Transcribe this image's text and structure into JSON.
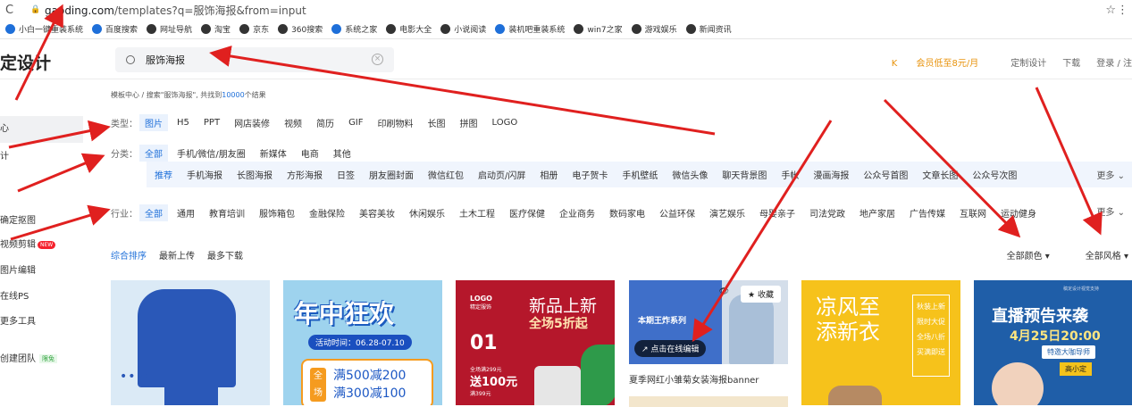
{
  "browser": {
    "url_host": "gaoding.com",
    "url_path": "/templates?q=服饰海报&from=input"
  },
  "bookmarks": [
    {
      "label": "小白一键重装系统",
      "icon": "gear-icon"
    },
    {
      "label": "百度搜索",
      "icon": "paw-icon"
    },
    {
      "label": "网址导航",
      "icon": "globe-icon"
    },
    {
      "label": "淘宝",
      "icon": "globe-icon"
    },
    {
      "label": "京东",
      "icon": "globe-icon"
    },
    {
      "label": "360搜索",
      "icon": "globe-icon"
    },
    {
      "label": "系统之家",
      "icon": "gear-icon"
    },
    {
      "label": "电影大全",
      "icon": "globe-icon"
    },
    {
      "label": "小说阅读",
      "icon": "globe-icon"
    },
    {
      "label": "装机吧重装系统",
      "icon": "computer-icon"
    },
    {
      "label": "win7之家",
      "icon": "globe-icon"
    },
    {
      "label": "游戏娱乐",
      "icon": "globe-icon"
    },
    {
      "label": "新闻资讯",
      "icon": "globe-icon"
    }
  ],
  "header": {
    "logo": "定设计",
    "search_value": "服饰海报",
    "vip": "会员低至8元/月",
    "custom_design": "定制设计",
    "download": "下载",
    "login": "登录 / 注"
  },
  "sidebar": {
    "items": [
      {
        "label": "心"
      },
      {
        "label": "计"
      },
      {
        "label": "确定抠图"
      },
      {
        "label": "视频剪辑",
        "badge": "NEW"
      },
      {
        "label": "图片编辑"
      },
      {
        "label": "在线PS"
      },
      {
        "label": "更多工具"
      },
      {
        "label": "创建团队",
        "badge": "限免"
      }
    ]
  },
  "breadcrumb": {
    "prefix": "模板中心 / 搜索\"服饰海报\", 共找到",
    "count": "10000",
    "suffix": "个结果"
  },
  "filters": {
    "type_label": "类型：",
    "types": [
      "图片",
      "H5",
      "PPT",
      "网店装修",
      "视频",
      "简历",
      "GIF",
      "印刷物料",
      "长图",
      "拼图",
      "LOGO"
    ],
    "category_label": "分类：",
    "categories": [
      "全部",
      "手机/微信/朋友圈",
      "新媒体",
      "电商",
      "其他"
    ],
    "subcategories": [
      "推荐",
      "手机海报",
      "长图海报",
      "方形海报",
      "日签",
      "朋友圈封面",
      "微信红包",
      "启动页/闪屏",
      "相册",
      "电子贺卡",
      "手机壁纸",
      "微信头像",
      "聊天背景图",
      "手帐",
      "漫画海报",
      "公众号首图",
      "文章长图",
      "公众号次图"
    ],
    "industry_label": "行业：",
    "industries": [
      "全部",
      "通用",
      "教育培训",
      "服饰箱包",
      "金融保险",
      "美容美妆",
      "休闲娱乐",
      "土木工程",
      "医疗保健",
      "企业商务",
      "数码家电",
      "公益环保",
      "演艺娱乐",
      "母婴亲子",
      "司法党政",
      "地产家居",
      "广告传媒",
      "互联网",
      "运动健身"
    ],
    "more": "更多"
  },
  "sort": {
    "options": [
      "综合排序",
      "最新上传",
      "最多下载"
    ],
    "color": "全部颜色",
    "style": "全部风格"
  },
  "cards": {
    "c2": {
      "title": "年中狂欢",
      "date": "活动时间：06.28-07.10",
      "quan": "全场",
      "line1": "满500减200",
      "line2": "满300减100"
    },
    "c3": {
      "logo": "LOGO",
      "logo_sub": "精定服饰",
      "h1": "新品上新",
      "h2": "全场5折起",
      "num": "01",
      "s1": "全场满299元",
      "s2": "送100元",
      "s3": "满399元"
    },
    "c4": {
      "title": "夏季网红小雏菊女装海报banner",
      "fav": "收藏",
      "edit": "点击在线编辑",
      "banner": "本期王炸系列"
    },
    "c5": {
      "k1": "凉风至",
      "k2": "添新衣",
      "tag": [
        "秋装上新",
        "限时大促",
        "全场八折",
        "买满即送"
      ]
    },
    "c6": {
      "small": "稿定设计视觉支持",
      "hd": "直播预告来袭",
      "dt": "4月25日20:00",
      "pill": "特邀大咖导师",
      "pill2": "高小定"
    }
  },
  "colors": {
    "accent": "#1e6fd9",
    "annotation": "#e0201f"
  }
}
